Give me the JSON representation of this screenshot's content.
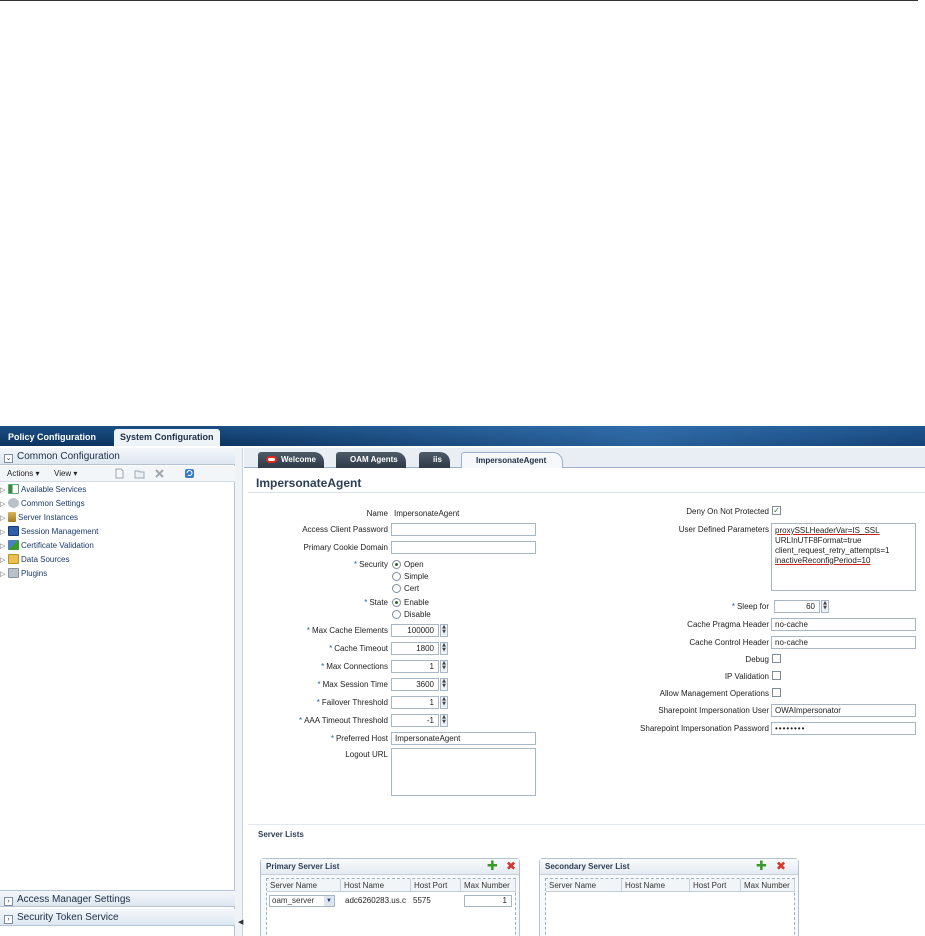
{
  "top_tabs": [
    "Policy Configuration",
    "System Configuration"
  ],
  "left": {
    "common_configuration": "Common Configuration",
    "toolbar": {
      "actions": "Actions ▾",
      "view": "View ▾"
    },
    "tree": [
      "Available Services",
      "Common Settings",
      "Server Instances",
      "Session Management",
      "Certificate Validation",
      "Data Sources",
      "Plugins"
    ],
    "access_manager_settings": "Access Manager Settings",
    "security_token_service": "Security Token Service"
  },
  "doc_tabs": [
    "Welcome",
    "OAM Agents",
    "iis",
    "ImpersonateAgent"
  ],
  "page_title": "ImpersonateAgent",
  "form": {
    "name_label": "Name",
    "name_value": "ImpersonateAgent",
    "access_client_password_label": "Access Client Password",
    "primary_cookie_domain_label": "Primary Cookie Domain",
    "security_label": "Security",
    "security_options": [
      "Open",
      "Simple",
      "Cert"
    ],
    "state_label": "State",
    "state_options": [
      "Enable",
      "Disable"
    ],
    "max_cache_elements_label": "Max Cache Elements",
    "max_cache_elements": "100000",
    "cache_timeout_label": "Cache Timeout",
    "cache_timeout": "1800",
    "max_connections_label": "Max Connections",
    "max_connections": "1",
    "max_session_time_label": "Max Session Time",
    "max_session_time": "3600",
    "failover_threshold_label": "Failover Threshold",
    "failover_threshold": "1",
    "aaa_timeout_threshold_label": "AAA Timeout Threshold",
    "aaa_timeout_threshold": "-1",
    "preferred_host_label": "Preferred Host",
    "preferred_host": "ImpersonateAgent",
    "logout_url_label": "Logout URL",
    "deny_on_not_protected_label": "Deny On Not Protected",
    "user_defined_parameters_label": "User Defined Parameters",
    "user_defined_parameters": [
      "proxySSLHeaderVar=IS_SSL",
      "URLInUTF8Format=true",
      "client_request_retry_attempts=1",
      "inactiveReconfigPeriod=10"
    ],
    "sleep_for_label": "Sleep for",
    "sleep_for": "60",
    "cache_pragma_header_label": "Cache Pragma Header",
    "cache_pragma_header": "no-cache",
    "cache_control_header_label": "Cache Control Header",
    "cache_control_header": "no-cache",
    "debug_label": "Debug",
    "ip_validation_label": "IP Validation",
    "allow_management_operations_label": "Allow Management Operations",
    "sharepoint_impersonation_user_label": "Sharepoint Impersonation User",
    "sharepoint_impersonation_user": "OWAImpersonator",
    "sharepoint_impersonation_password_label": "Sharepoint Impersonation Password",
    "sharepoint_impersonation_password": "••••••••"
  },
  "server_lists": {
    "title": "Server Lists",
    "primary": {
      "title": "Primary Server List",
      "columns": [
        "Server Name",
        "Host Name",
        "Host Port",
        "Max Number"
      ],
      "rows": [
        {
          "server": "oam_server",
          "host": "adc6260283.us.c",
          "port": "5575",
          "max": "1"
        }
      ]
    },
    "secondary": {
      "title": "Secondary Server List",
      "columns": [
        "Server Name",
        "Host Name",
        "Host Port",
        "Max Number"
      ]
    }
  },
  "colors": {
    "topbar": "#0c3460",
    "accent_required": "#1b5fa8",
    "add": "#3a9a2a",
    "delete": "#d9342b"
  }
}
